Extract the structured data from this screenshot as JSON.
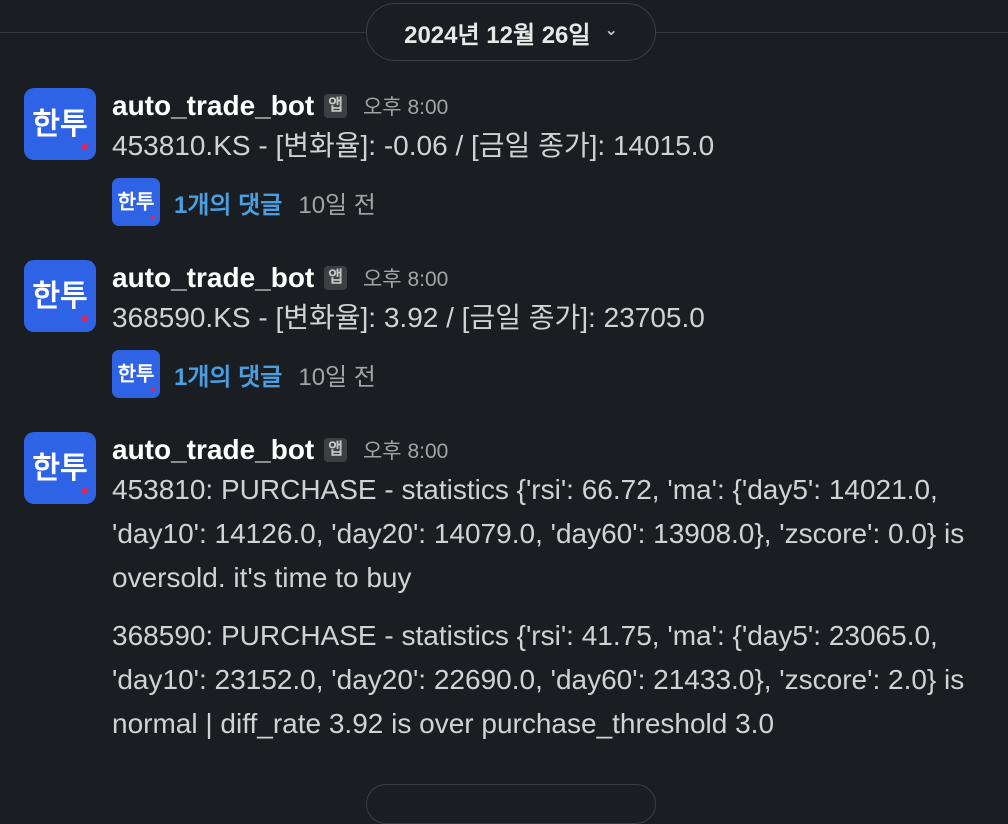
{
  "date_divider": {
    "label": "2024년 12월 26일"
  },
  "messages": [
    {
      "sender": "auto_trade_bot",
      "badge": "앱",
      "time": "오후 8:00",
      "text": "453810.KS - [변화율]: -0.06 / [금일 종가]: 14015.0",
      "thread": {
        "replies": "1개의 댓글",
        "last_reply": "10일 전"
      }
    },
    {
      "sender": "auto_trade_bot",
      "badge": "앱",
      "time": "오후 8:00",
      "text": "368590.KS - [변화율]: 3.92 / [금일 종가]: 23705.0",
      "thread": {
        "replies": "1개의 댓글",
        "last_reply": "10일 전"
      }
    },
    {
      "sender": "auto_trade_bot",
      "badge": "앱",
      "time": "오후 8:00",
      "paragraphs": [
        "453810: PURCHASE - statistics {'rsi': 66.72, 'ma': {'day5': 14021.0, 'day10': 14126.0, 'day20': 14079.0, 'day60': 13908.0}, 'zscore': 0.0} is oversold. it's time to buy",
        "368590: PURCHASE - statistics {'rsi': 41.75, 'ma': {'day5': 23065.0, 'day10': 23152.0, 'day20': 22690.0, 'day60': 21433.0}, 'zscore': 2.0} is normal | diff_rate 3.92 is over purchase_threshold 3.0"
      ]
    }
  ],
  "avatar_text": "한투",
  "icons": {
    "date_dropdown": "chevron-down-icon"
  },
  "colors": {
    "background": "#1a1d21",
    "link": "#4a9fe0",
    "avatar_bg": "#2f63e6",
    "avatar_dot": "#e0245e"
  }
}
